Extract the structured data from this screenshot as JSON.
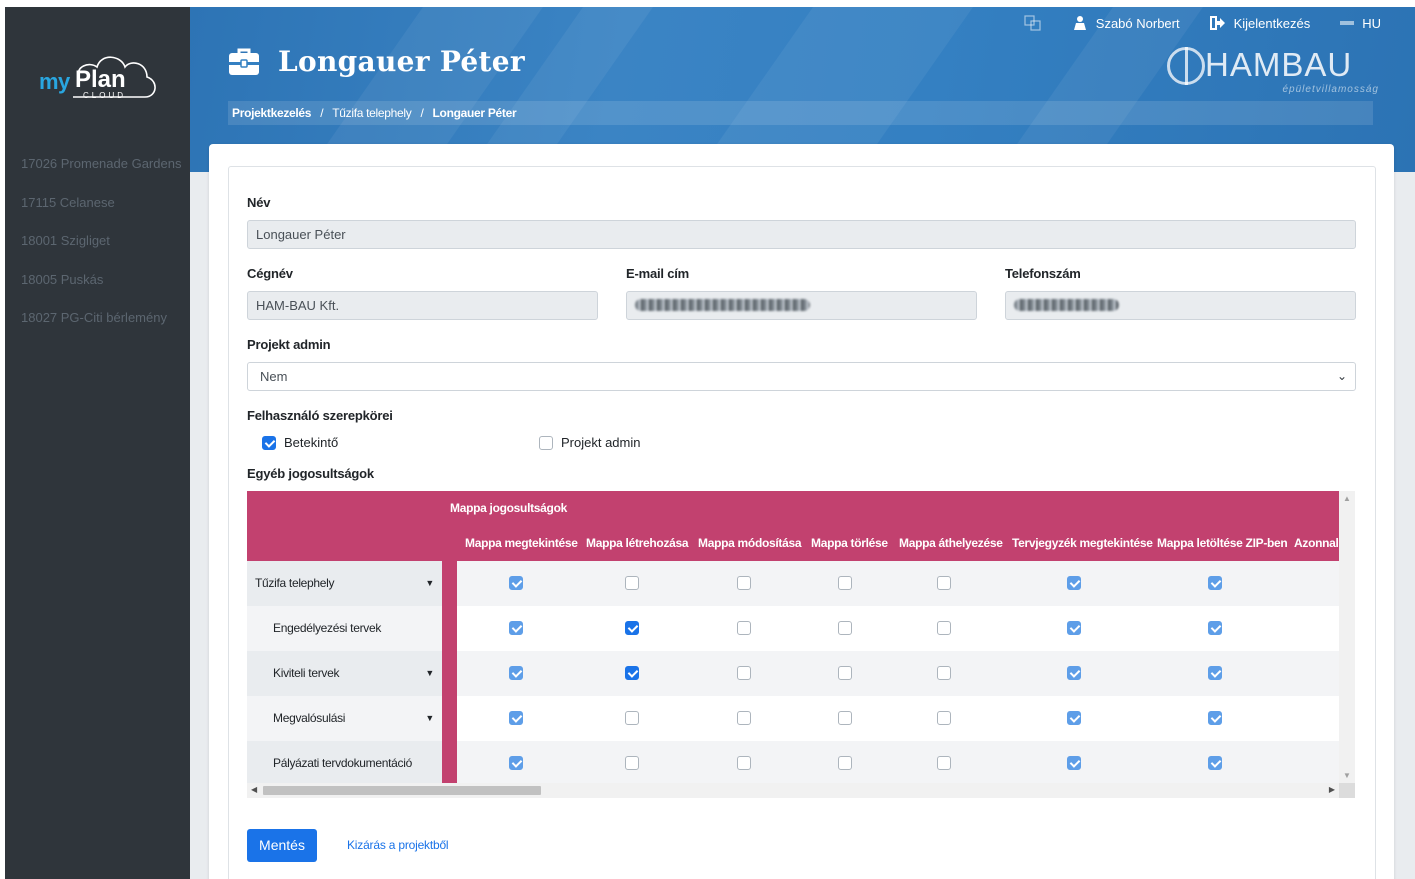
{
  "sidebar": {
    "logo_my": "my",
    "logo_plan": "Plan",
    "logo_cloud": "CLOUD",
    "projects": [
      "17026 Promenade Gardens",
      "17115 Celanese",
      "18001 Szigliget",
      "18005 Puskás",
      "18027 PG-Citi bérlemény"
    ]
  },
  "topbar": {
    "user": "Szabó Norbert",
    "logout": "Kijelentkezés",
    "lang": "HU"
  },
  "header": {
    "title": "Longauer Péter",
    "brand_name": "HAMBAU",
    "brand_sub": "épületvillamosság",
    "breadcrumb": [
      "Projektkezelés",
      "Tűzifa telephely",
      "Longauer Péter"
    ]
  },
  "form": {
    "name_label": "Név",
    "name_value": "Longauer Péter",
    "company_label": "Cégnév",
    "company_value": "HAM-BAU Kft.",
    "email_label": "E-mail cím",
    "phone_label": "Telefonszám",
    "admin_label": "Projekt admin",
    "admin_value": "Nem",
    "roles_label": "Felhasználó szerepkörei",
    "roles": [
      {
        "label": "Betekintő",
        "checked": true
      },
      {
        "label": "Projekt admin",
        "checked": false
      }
    ],
    "other_label": "Egyéb jogosultságok"
  },
  "permissions": {
    "group": "Mappa jogosultságok",
    "columns": [
      "Mappa megtekintése",
      "Mappa létrehozása",
      "Mappa módosítása",
      "Mappa törlése",
      "Mappa áthelyezése",
      "Tervjegyzék megtekintése",
      "Mappa letöltése ZIP-ben",
      "Azonnali"
    ],
    "rows": [
      {
        "name": "Tűzifa telephely",
        "indent": false,
        "caret": true,
        "values": [
          "soft",
          "off",
          "off",
          "off",
          "off",
          "soft",
          "soft"
        ]
      },
      {
        "name": "Engedélyezési tervek",
        "indent": true,
        "caret": false,
        "values": [
          "soft",
          "on",
          "off",
          "off",
          "off",
          "soft",
          "soft"
        ]
      },
      {
        "name": "Kiviteli tervek",
        "indent": true,
        "caret": true,
        "values": [
          "soft",
          "on",
          "off",
          "off",
          "off",
          "soft",
          "soft"
        ]
      },
      {
        "name": "Megvalósulási",
        "indent": true,
        "caret": true,
        "values": [
          "soft",
          "off",
          "off",
          "off",
          "off",
          "soft",
          "soft"
        ]
      },
      {
        "name": "Pályázati tervdokumentáció",
        "indent": true,
        "caret": false,
        "values": [
          "soft",
          "off",
          "off",
          "off",
          "off",
          "soft",
          "soft"
        ]
      }
    ]
  },
  "actions": {
    "save": "Mentés",
    "kick": "Kizárás a projektből"
  },
  "colors": {
    "accent": "#1a73e8",
    "table_header": "#c2416f",
    "sidebar": "#2f353b",
    "header": "#3480c2"
  }
}
